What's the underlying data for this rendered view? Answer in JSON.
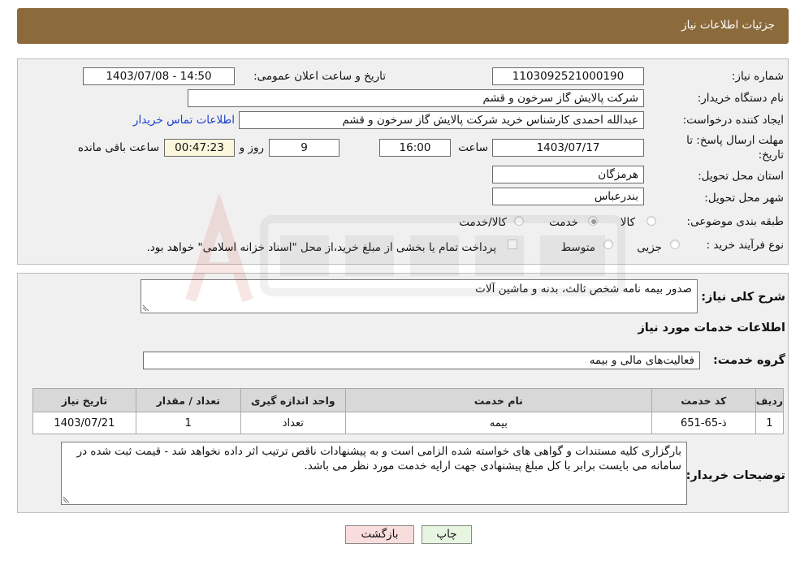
{
  "header": {
    "title": "جزئیات اطلاعات نیاز"
  },
  "form": {
    "need_number_label": "شماره نیاز:",
    "need_number": "1103092521000190",
    "announce_datetime_label": "تاریخ و ساعت اعلان عمومی:",
    "announce_datetime": "1403/07/08 - 14:50",
    "buyer_org_label": "نام دستگاه خریدار:",
    "buyer_org": "شرکت پالایش گاز سرخون و قشم",
    "requester_label": "ایجاد کننده درخواست:",
    "requester": "عبدالله احمدی کارشناس خرید شرکت پالایش گاز سرخون و قشم",
    "buyer_contact_link": "اطلاعات تماس خریدار",
    "deadline_label_line1": "مهلت ارسال پاسخ: تا",
    "deadline_label_line2": "تاریخ:",
    "deadline_date": "1403/07/17",
    "time_label": "ساعت",
    "deadline_time": "16:00",
    "days": "9",
    "days_label": "روز و",
    "remaining_time": "00:47:23",
    "remaining_label": "ساعت باقی مانده",
    "province_label": "استان محل تحویل:",
    "province": "هرمزگان",
    "city_label": "شهر محل تحویل:",
    "city": "بندرعباس",
    "category_label": "طبقه بندی موضوعی:",
    "category_options": [
      "کالا",
      "خدمت",
      "کالا/خدمت"
    ],
    "category_selected": "خدمت",
    "process_label": "نوع فرآیند خرید :",
    "process_options": [
      "جزیی",
      "متوسط"
    ],
    "payment_note": "پرداخت تمام یا بخشی از مبلغ خرید،از محل \"اسناد خزانه اسلامی\" خواهد بود."
  },
  "summary": {
    "general_desc_label": "شرح کلی نیاز:",
    "general_desc": "صدور بیمه نامه شخص ثالث، بدنه و ماشین آلات",
    "services_heading": "اطلاعات خدمات مورد نیاز",
    "service_group_label": "گروه خدمت:",
    "service_group": "فعالیت‌های مالی و بیمه"
  },
  "table": {
    "headers": [
      "ردیف",
      "کد خدمت",
      "نام خدمت",
      "واحد اندازه گیری",
      "تعداد / مقدار",
      "تاریخ نیاز"
    ],
    "rows": [
      [
        "1",
        "ذ-65-651",
        "بیمه",
        "تعداد",
        "1",
        "1403/07/21"
      ]
    ]
  },
  "buyer_notes": {
    "label": "توضیحات خریدار:",
    "text": "بارگزاری کلیه مستندات و گواهی های خواسته شده الزامی است و به پیشنهادات ناقص ترتیب اثر داده نخواهد شد - قیمت ثبت شده در سامانه می بایست برابر با کل مبلغ پیشنهادی جهت ارایه خدمت مورد نظر می باشد."
  },
  "buttons": {
    "print": "چاپ",
    "back": "بازگشت"
  },
  "colors": {
    "header_bg": "#8b6a3b",
    "panel_bg": "#f0f0f0",
    "print_btn_bg": "#e6f5e0",
    "back_btn_bg": "#f9dcdc",
    "link": "#1a3ecc"
  }
}
